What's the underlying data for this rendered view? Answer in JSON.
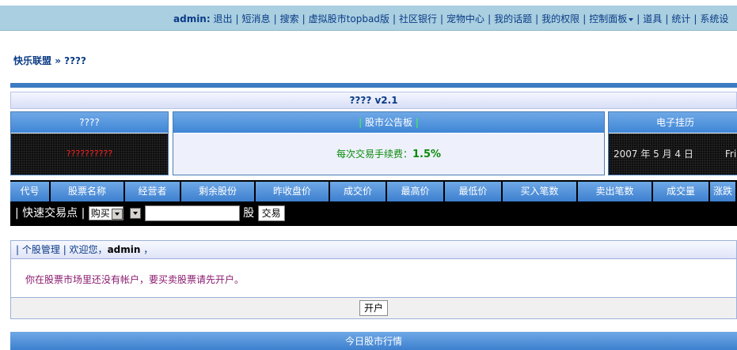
{
  "topnav": {
    "user": "admin:",
    "items": [
      "退出",
      "短消息",
      "搜索",
      "虚拟股市topbad版",
      "社区银行",
      "宠物中心",
      "我的话题",
      "我的权限",
      "控制面板",
      "道具",
      "统计",
      "系统设"
    ]
  },
  "breadcrumb": {
    "home": "快乐联盟",
    "sep": " » ",
    "current": "????"
  },
  "title": "???? v2.1",
  "panels": {
    "left_header": "????",
    "left_body": "??????????",
    "board_header": "股市公告板",
    "board_label": "每次交易手续费：",
    "board_value": "1.5%",
    "clock_header": "电子挂历",
    "clock_date": "2007 年 5 月 4 日",
    "clock_day": "Fri"
  },
  "table": {
    "columns": [
      "代号",
      "股票名称",
      "经营者",
      "剩余股份",
      "昨收盘价",
      "成交价",
      "最高价",
      "最低价",
      "买入笔数",
      "卖出笔数",
      "成交量",
      "涨跌"
    ]
  },
  "quick_trade": {
    "label": "| 快速交易点 |",
    "action": "购买",
    "unit": "股",
    "submit": "交易"
  },
  "user_box": {
    "tab": "个股管理",
    "welcome": "欢迎您，",
    "username": "admin",
    "trailing": "，",
    "message": "你在股票市场里还没有帐户，要买卖股票请先开户。",
    "open_button": "开户"
  },
  "market": {
    "title": "今日股市行情"
  }
}
